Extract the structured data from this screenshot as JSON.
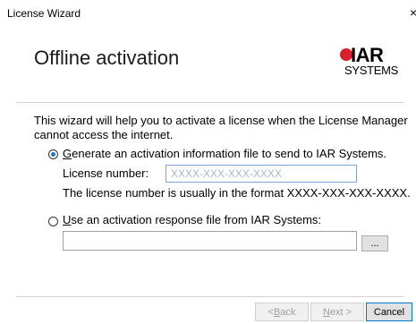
{
  "window": {
    "title": "License Wizard",
    "close_glyph": "×"
  },
  "header": {
    "page_title": "Offline activation",
    "logo_word": "IAR",
    "logo_sub": "SYSTEMS",
    "logo_color": "#d8202a"
  },
  "intro": {
    "line1": "This wizard will help you to activate a license when the License Manager",
    "line2": "cannot access the internet."
  },
  "option_generate": {
    "mnemonic": "G",
    "label_rest": "enerate an activation information file to send to IAR Systems.",
    "selected": true
  },
  "license": {
    "label": "License number:",
    "placeholder": "XXXX-XXX-XXX-XXXX",
    "value": "",
    "hint": "The license number is usually in the format XXXX-XXX-XXX-XXXX."
  },
  "option_response": {
    "mnemonic": "U",
    "label_rest": "se an activation response file from IAR Systems:",
    "selected": false,
    "file_path": ""
  },
  "browse_button": {
    "label": "..."
  },
  "footer": {
    "back": {
      "mnemonic": "B",
      "prefix": "< ",
      "rest": "ack"
    },
    "next": {
      "mnemonic": "N",
      "rest": "ext >"
    },
    "cancel": {
      "label": "Cancel"
    }
  }
}
